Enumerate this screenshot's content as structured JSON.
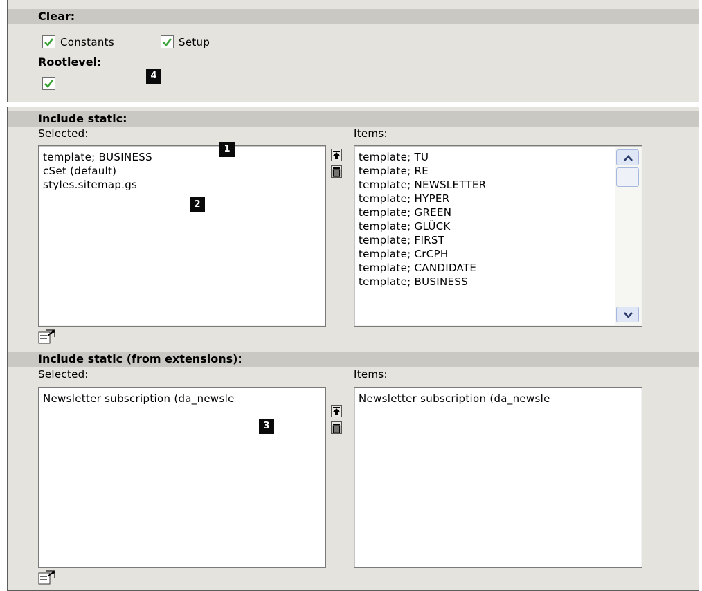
{
  "clear": {
    "heading": "Clear:",
    "constants_label": "Constants",
    "constants_checked": true,
    "setup_label": "Setup",
    "setup_checked": true
  },
  "rootlevel": {
    "heading": "Rootlevel:",
    "checked": true
  },
  "include_static": {
    "heading": "Include static:",
    "selected_label": "Selected:",
    "items_label": "Items:",
    "selected": [
      "template; BUSINESS",
      "cSet (default)",
      "styles.sitemap.gs"
    ],
    "items": [
      "template; TU",
      "template; RE",
      "template; NEWSLETTER",
      "template; HYPER",
      "template; GREEN",
      "template; GLÜCK",
      "template; FIRST",
      "template; CrCPH",
      "template; CANDIDATE",
      "template; BUSINESS"
    ]
  },
  "include_static_ext": {
    "heading": "Include static (from extensions):",
    "selected_label": "Selected:",
    "items_label": "Items:",
    "selected": [
      "Newsletter subscription (da_newsle"
    ],
    "items": [
      "Newsletter subscription (da_newsle"
    ]
  },
  "badges": [
    "1",
    "2",
    "3",
    "4"
  ],
  "icons": {
    "move_top": "arrow-to-top-icon",
    "remove": "trash-icon",
    "wizard": "edit-wizard-icon",
    "scroll_up": "chevron-up-icon",
    "scroll_down": "chevron-down-icon"
  },
  "colors": {
    "panel_bg": "#e4e3de",
    "header_bg": "#c9c8c2",
    "check_green": "#3aa335",
    "badge_bg": "#0a0a0a",
    "scroll_blue": "#dfe7f7"
  }
}
